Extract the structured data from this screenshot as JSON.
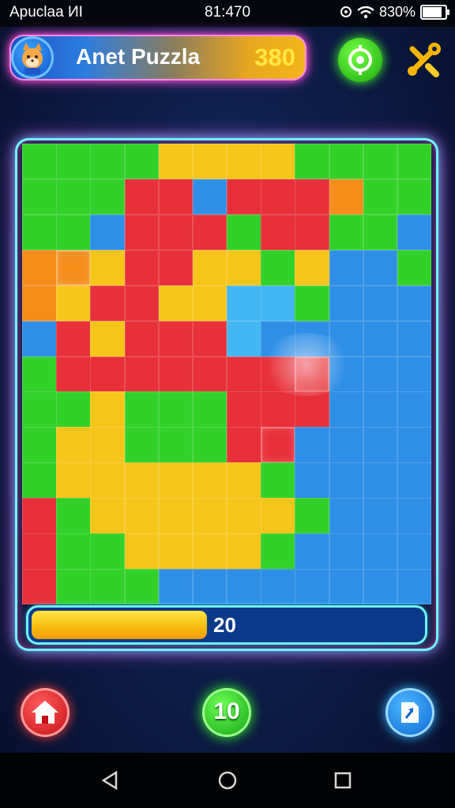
{
  "status_bar": {
    "left_text": "Apuclaa ИI",
    "time": "81:470",
    "battery_text": "830%"
  },
  "header": {
    "player_name": "Anet Puzzla",
    "score": "380",
    "avatar_icon": "fox-avatar-icon",
    "hint_icon": "target-icon",
    "settings_icon": "wrench-icon"
  },
  "board": {
    "progress_label": "20",
    "progress_fraction": 0.45
  },
  "bottom_bar": {
    "home_icon": "home-icon",
    "moves_count": "10",
    "share_icon": "share-icon"
  },
  "colors": {
    "green": "#32d12a",
    "yellow": "#f6c51a",
    "red": "#e8303a",
    "blue": "#2f8fe6",
    "orange": "#f58d1a",
    "neon_cyan": "#6ff6ff",
    "neon_pink": "#ff4ff0"
  }
}
